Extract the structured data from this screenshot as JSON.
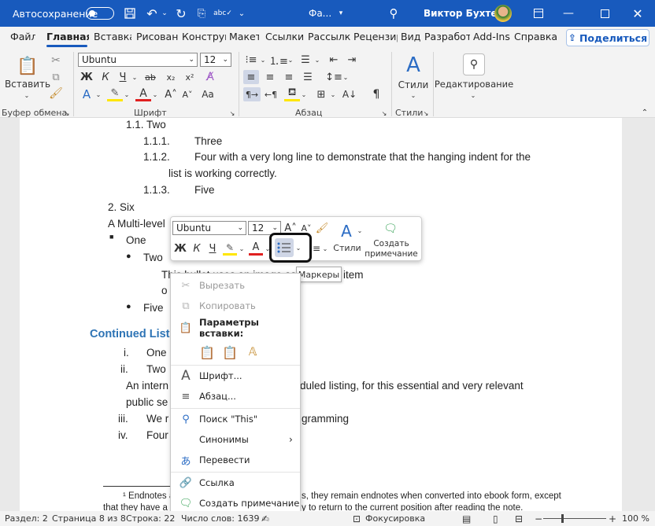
{
  "titlebar": {
    "autosave_label": "Автосохранение",
    "filename": "Фа...",
    "user": "Виктор Бухтеев"
  },
  "tabs": [
    "Файл",
    "Главная",
    "Вставка",
    "Рисовани",
    "Конструк",
    "Макет",
    "Ссылки",
    "Рассылки",
    "Рецензир",
    "Вид",
    "Разработ",
    "Add-Ins",
    "Справка"
  ],
  "share_label": "Поделиться",
  "ribbon": {
    "paste_label": "Вставить",
    "font_name": "Ubuntu",
    "font_size": "12",
    "bold": "Ж",
    "italic": "К",
    "underline": "Ч",
    "styles_label": "Стили",
    "editing_label": "Редактирование",
    "groups": {
      "clipboard": "Буфер обмена",
      "font": "Шрифт",
      "paragraph": "Абзац",
      "styles": "Стили"
    }
  },
  "document": {
    "lines": [
      "1.1. Two",
      "1.1.1.",
      "Three",
      "1.1.2.",
      "Four with a very long line to demonstrate that the hanging indent for the",
      "list is working correctly.",
      "1.1.3.",
      "Five",
      "2.  Six",
      "A Multi-level",
      "One",
      "Two",
      "This bullet uses an image as",
      "item",
      "o",
      "Five",
      "Continued Lists",
      "i.",
      "One",
      "ii.",
      "Two",
      "An intern",
      "duled listing, for this essential and very relevant",
      "public se",
      "iii.",
      "We r",
      "gramming",
      "iv.",
      "Four",
      "¹ Endnotes a",
      "s, they remain endnotes when converted into ebook form, except",
      "that they have a",
      "y to return to the current position after reading the note."
    ]
  },
  "mini_toolbar": {
    "font_name": "Ubuntu",
    "font_size": "12",
    "bold": "Ж",
    "italic": "К",
    "underline": "Ч",
    "styles_label": "Стили",
    "comment_label_1": "Создать",
    "comment_label_2": "примечание"
  },
  "tooltip": "Маркеры",
  "context_menu": {
    "cut": "Вырезать",
    "copy": "Копировать",
    "paste_options": "Параметры вставки:",
    "font": "Шрифт...",
    "paragraph": "Абзац...",
    "search": "Поиск \"This\"",
    "synonyms": "Синонимы",
    "translate": "Перевести",
    "link": "Ссылка",
    "comment": "Создать примечание"
  },
  "statusbar": {
    "section": "Раздел: 2",
    "page": "Страница 8 из 8",
    "line": "Строка: 22",
    "words": "Число слов: 1639",
    "focus": "Фокусировка",
    "zoom": "100 %"
  }
}
